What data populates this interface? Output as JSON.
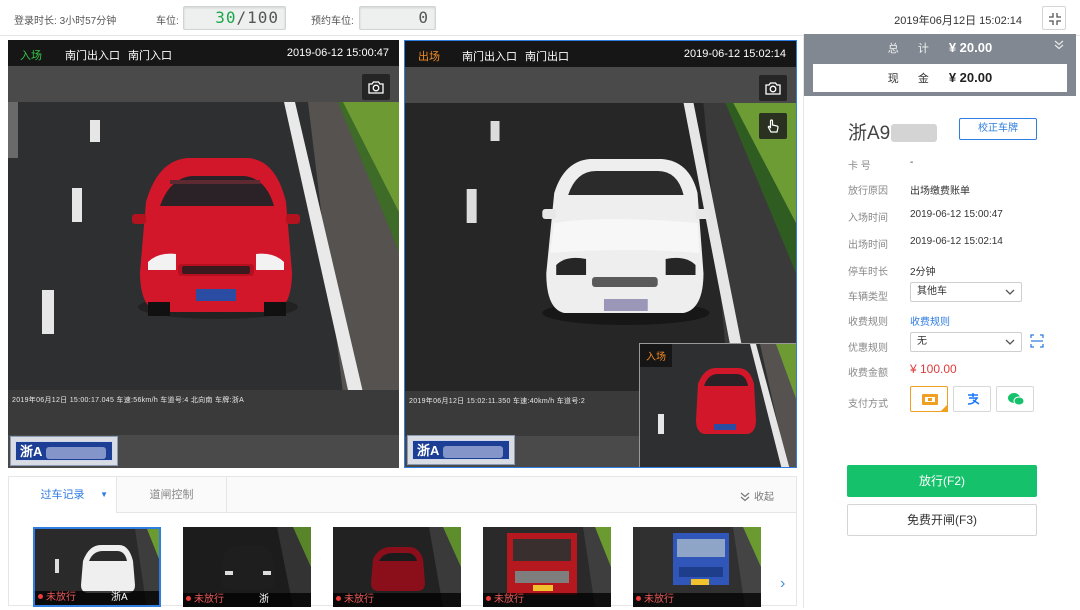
{
  "topbar": {
    "login_label": "登录时长: ",
    "login_value": "3小时57分钟",
    "spaces_label": "车位:",
    "spaces_used": "30",
    "spaces_sep": "/",
    "spaces_total": "100",
    "reserved_label": "预约车位:",
    "reserved_value": "0",
    "datetime": "2019年06月12日 15:02:14"
  },
  "entry_cam": {
    "direction": "入场",
    "gate1": "南门出入口",
    "gate2": "南门入口",
    "timestamp": "2019-06-12 15:00:47",
    "osd": "2019年06月12日  15:00:17.045   车速:56km/h   车道号:4   北向南   车牌:浙A",
    "plate_prefix": "浙A"
  },
  "exit_cam": {
    "direction": "出场",
    "gate1": "南门出入口",
    "gate2": "南门出口",
    "timestamp": "2019-06-12 15:02:14",
    "osd": "2019年06月12日  15:02:11.350   车速:40km/h   车道号:2",
    "plate_prefix": "浙A",
    "inset_label": "入场"
  },
  "records": {
    "tab_active": "过车记录",
    "tab_caret": "▼",
    "tab_second": "道闸控制",
    "collapse": "收起",
    "next": "›",
    "thumbs": [
      {
        "status": "未放行",
        "plate": "浙A"
      },
      {
        "status": "未放行",
        "plate": "浙"
      },
      {
        "status": "未放行",
        "plate": ""
      },
      {
        "status": "未放行",
        "plate": ""
      },
      {
        "status": "未放行",
        "plate": ""
      }
    ]
  },
  "payment": {
    "total_label": "总 计",
    "total_value": "¥ 20.00",
    "cash_label": "现 金",
    "cash_value": "¥ 20.00",
    "plate": "浙A9",
    "fix_plate_btn": "校正车牌",
    "fields": {
      "card_label": "卡    号",
      "card_value": "-",
      "reason_label": "放行原因",
      "reason_value": "出场缴费账单",
      "in_time_label": "入场时间",
      "in_time_value": "2019-06-12 15:00:47",
      "out_time_label": "出场时间",
      "out_time_value": "2019-06-12 15:02:14",
      "duration_label": "停车时长",
      "duration_value": "2分钟",
      "vehicle_type_label": "车辆类型",
      "vehicle_type_value": "其他车",
      "rule_label": "收费规则",
      "rule_value": "收费规则",
      "discount_label": "优惠规则",
      "discount_value": "无",
      "amount_label": "收费金额",
      "amount_value": "¥ 100.00",
      "method_label": "支付方式"
    },
    "release_btn": "放行(F2)",
    "free_btn": "免费开闸(F3)"
  },
  "colors": {
    "accent_blue": "#2f7de1",
    "release_green": "#15c26b",
    "amount_red": "#e03b3b",
    "lcd_green": "#1aa84a"
  }
}
